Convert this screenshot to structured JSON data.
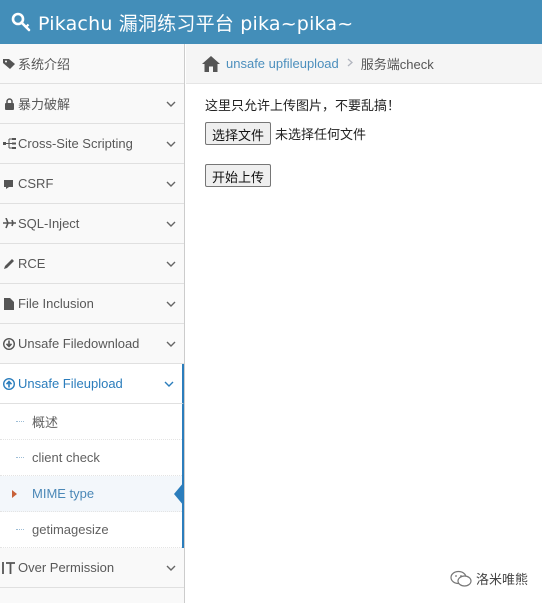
{
  "header": {
    "title": "Pikachu 漏洞练习平台 pika~pika~",
    "bg": "#438eb9"
  },
  "sidebar": {
    "items": [
      {
        "label": "系统介绍",
        "icon": "tag-icon"
      },
      {
        "label": "暴力破解",
        "icon": "lock-icon"
      },
      {
        "label": "Cross-Site Scripting",
        "icon": "sitemap-icon"
      },
      {
        "label": "CSRF",
        "icon": "csrf-icon"
      },
      {
        "label": "SQL-Inject",
        "icon": "plane-icon"
      },
      {
        "label": "RCE",
        "icon": "pencil-icon"
      },
      {
        "label": "File Inclusion",
        "icon": "file-icon"
      },
      {
        "label": "Unsafe Filedownload",
        "icon": "download-icon"
      },
      {
        "label": "Unsafe Fileupload",
        "icon": "upload-icon",
        "active": true
      }
    ],
    "subitems": [
      {
        "label": "概述"
      },
      {
        "label": "client check"
      },
      {
        "label": "MIME type",
        "active": true
      },
      {
        "label": "getimagesize"
      }
    ],
    "after_items": [
      {
        "label": "Over Permission",
        "icon": "text-cursor-icon"
      },
      {
        "label": "",
        "icon": "list-icon"
      }
    ],
    "active_color": "#2b7dbc"
  },
  "breadcrumb": {
    "parent": "unsafe upfileupload",
    "current": "服务端check"
  },
  "content": {
    "notice": "这里只允许上传图片，不要乱搞！",
    "choose_button": "选择文件",
    "file_status": "未选择任何文件",
    "upload_button": "开始上传"
  },
  "watermark": {
    "text": "洛米唯熊"
  }
}
